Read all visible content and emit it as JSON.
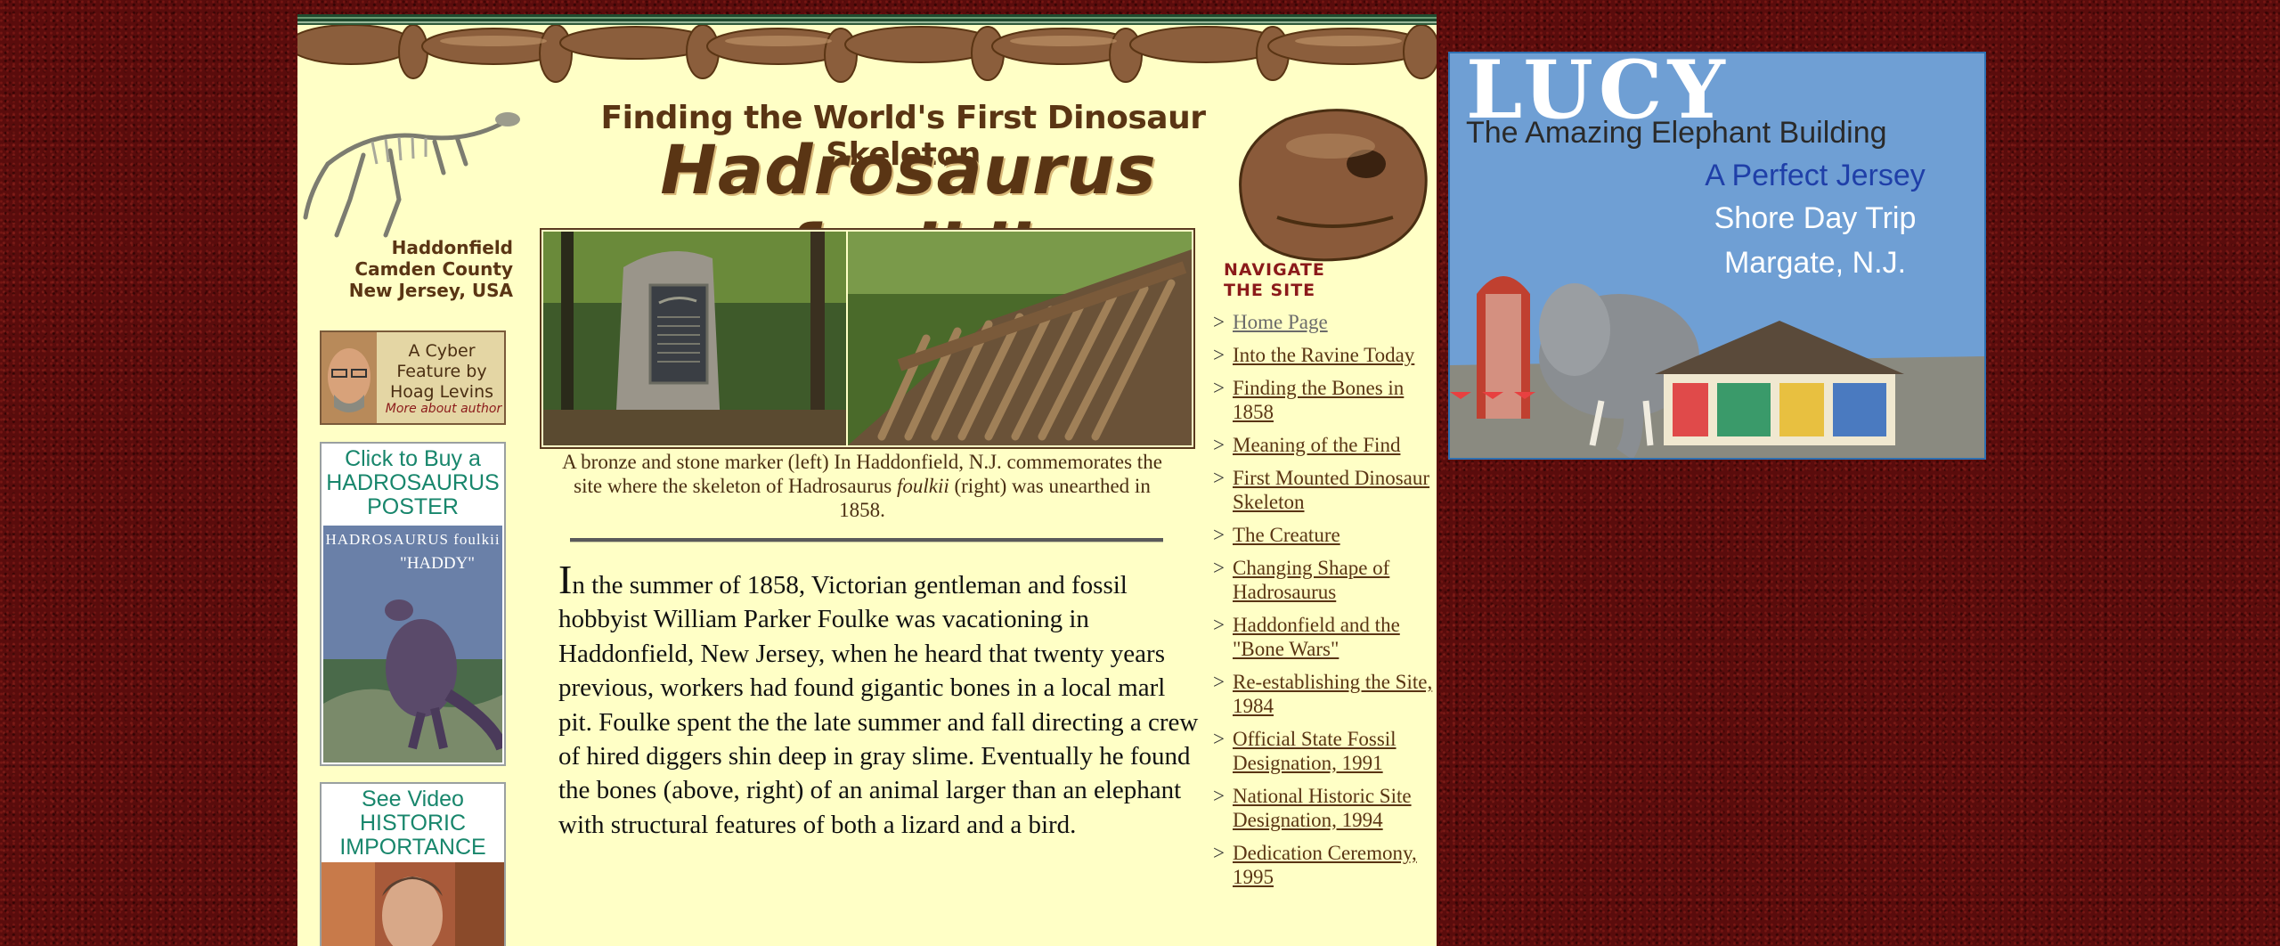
{
  "header": {
    "kicker": "Finding the World's First Dinosaur Skeleton",
    "title": "Hadrosaurus foulkii",
    "location": [
      "Haddonfield",
      "Camden County",
      "New Jersey, USA"
    ]
  },
  "author_promo": {
    "text": [
      "A Cyber",
      "Feature by",
      "Hoag Levins"
    ],
    "more": "More about author"
  },
  "poster_promo": {
    "heading": [
      "Click to Buy a",
      "HADROSAURUS",
      "POSTER"
    ],
    "art_title": "HADROSAURUS foulkii",
    "art_subtitle": "\"HADDY\""
  },
  "video_promo": {
    "heading": [
      "See Video",
      "HISTORIC",
      "IMPORTANCE"
    ]
  },
  "photo": {
    "caption_part1": "A bronze and stone marker (left) In Haddonfield, N.J. commemorates the site where the skeleton of Hadrosaurus",
    "caption_italic": "foulkii",
    "caption_part2": " (right) was unearthed in 1858."
  },
  "article": {
    "dropcap": "I",
    "paragraph": "n the summer of 1858, Victorian gentleman and fossil hobbyist William Parker Foulke was vacationing in Haddonfield, New Jersey, when he heard that twenty years previous, workers had found gigantic bones in a local marl pit. Foulke spent the the late summer and fall directing a crew of hired diggers shin deep in gray slime. Eventually he found the bones (above, right) of an animal larger than an elephant with structural features of both a lizard and a bird."
  },
  "nav": {
    "heading": [
      "NAVIGATE",
      "THE SITE"
    ],
    "arrow": ">",
    "items": [
      {
        "label": "Home Page",
        "current": true
      },
      {
        "label": "Into the Ravine Today"
      },
      {
        "label": "Finding the Bones in 1858"
      },
      {
        "label": "Meaning of the Find"
      },
      {
        "label": "First Mounted Dinosaur Skeleton"
      },
      {
        "label": "The Creature"
      },
      {
        "label": "Changing Shape of Hadrosaurus"
      },
      {
        "label": "Haddonfield and the \"Bone Wars\""
      },
      {
        "label": "Re-establishing the Site, 1984"
      },
      {
        "label": "Official State Fossil Designation, 1991"
      },
      {
        "label": "National Historic Site Designation, 1994"
      },
      {
        "label": "Dedication Ceremony, 1995"
      }
    ]
  },
  "lucy_ad": {
    "title": "LUCY",
    "subtitle": "The Amazing Elephant Building",
    "line1": "A Perfect Jersey",
    "line2": "Shore Day Trip",
    "line3": "Margate, N.J."
  },
  "colors": {
    "page_background": "#5a0c0c",
    "content_background": "#ffffc6",
    "banner_brown": "#5a3514",
    "nav_heading_red": "#8b1a1a",
    "promo_teal": "#18866c",
    "ad_blue": "#6f9fd4"
  }
}
